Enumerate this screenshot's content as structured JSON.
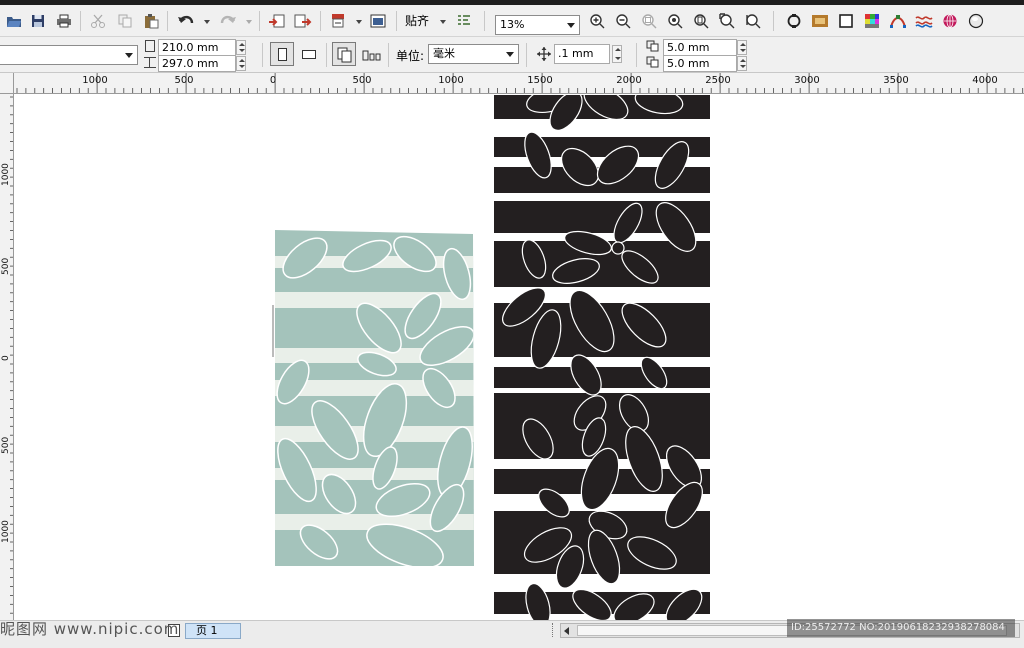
{
  "toolbar": {
    "snap_label": "贴齐",
    "zoom_value": "13%",
    "buttons": [
      "open-icon",
      "save-icon",
      "print-icon",
      "cut-icon",
      "copy-icon",
      "paste-icon",
      "undo-icon",
      "redo-icon",
      "import-icon",
      "export-icon",
      "publish-pdf-icon",
      "app-launcher-icon",
      "snap-options-icon",
      "zoom-in-icon",
      "zoom-out-icon",
      "zoom-fit-icon",
      "zoom-selected-icon",
      "zoom-page-icon",
      "zoom-width-icon",
      "zoom-height-icon",
      "outline-icon",
      "bitmap-icon",
      "frame-icon",
      "color-grid-icon",
      "node-icon",
      "wave-icon",
      "sphere-icon",
      "globe-icon"
    ]
  },
  "propbar": {
    "paper_preset": "",
    "width": "210.0 mm",
    "height": "297.0 mm",
    "unit_label": "单位:",
    "unit_value": "毫米",
    "nudge_value": ".1 mm",
    "dup_x": "5.0 mm",
    "dup_y": "5.0 mm"
  },
  "ruler": {
    "h_labels": [
      "1000",
      "500",
      "0",
      "500",
      "1000",
      "1500",
      "2000",
      "2500",
      "3000",
      "3500",
      "4000"
    ],
    "v_labels": [
      "1000",
      "500",
      "0",
      "500",
      "1000"
    ]
  },
  "status": {
    "page_tab": "页 1"
  },
  "watermark": {
    "left": "昵图网 www.nipic.com",
    "right": "ID:25572772 NO:20190618232938278084"
  },
  "colors": {
    "sage": "#a4c3bb",
    "stripe_light": "#e9efe9",
    "dark_pattern": "#231f20",
    "outline": "#ffffff"
  }
}
